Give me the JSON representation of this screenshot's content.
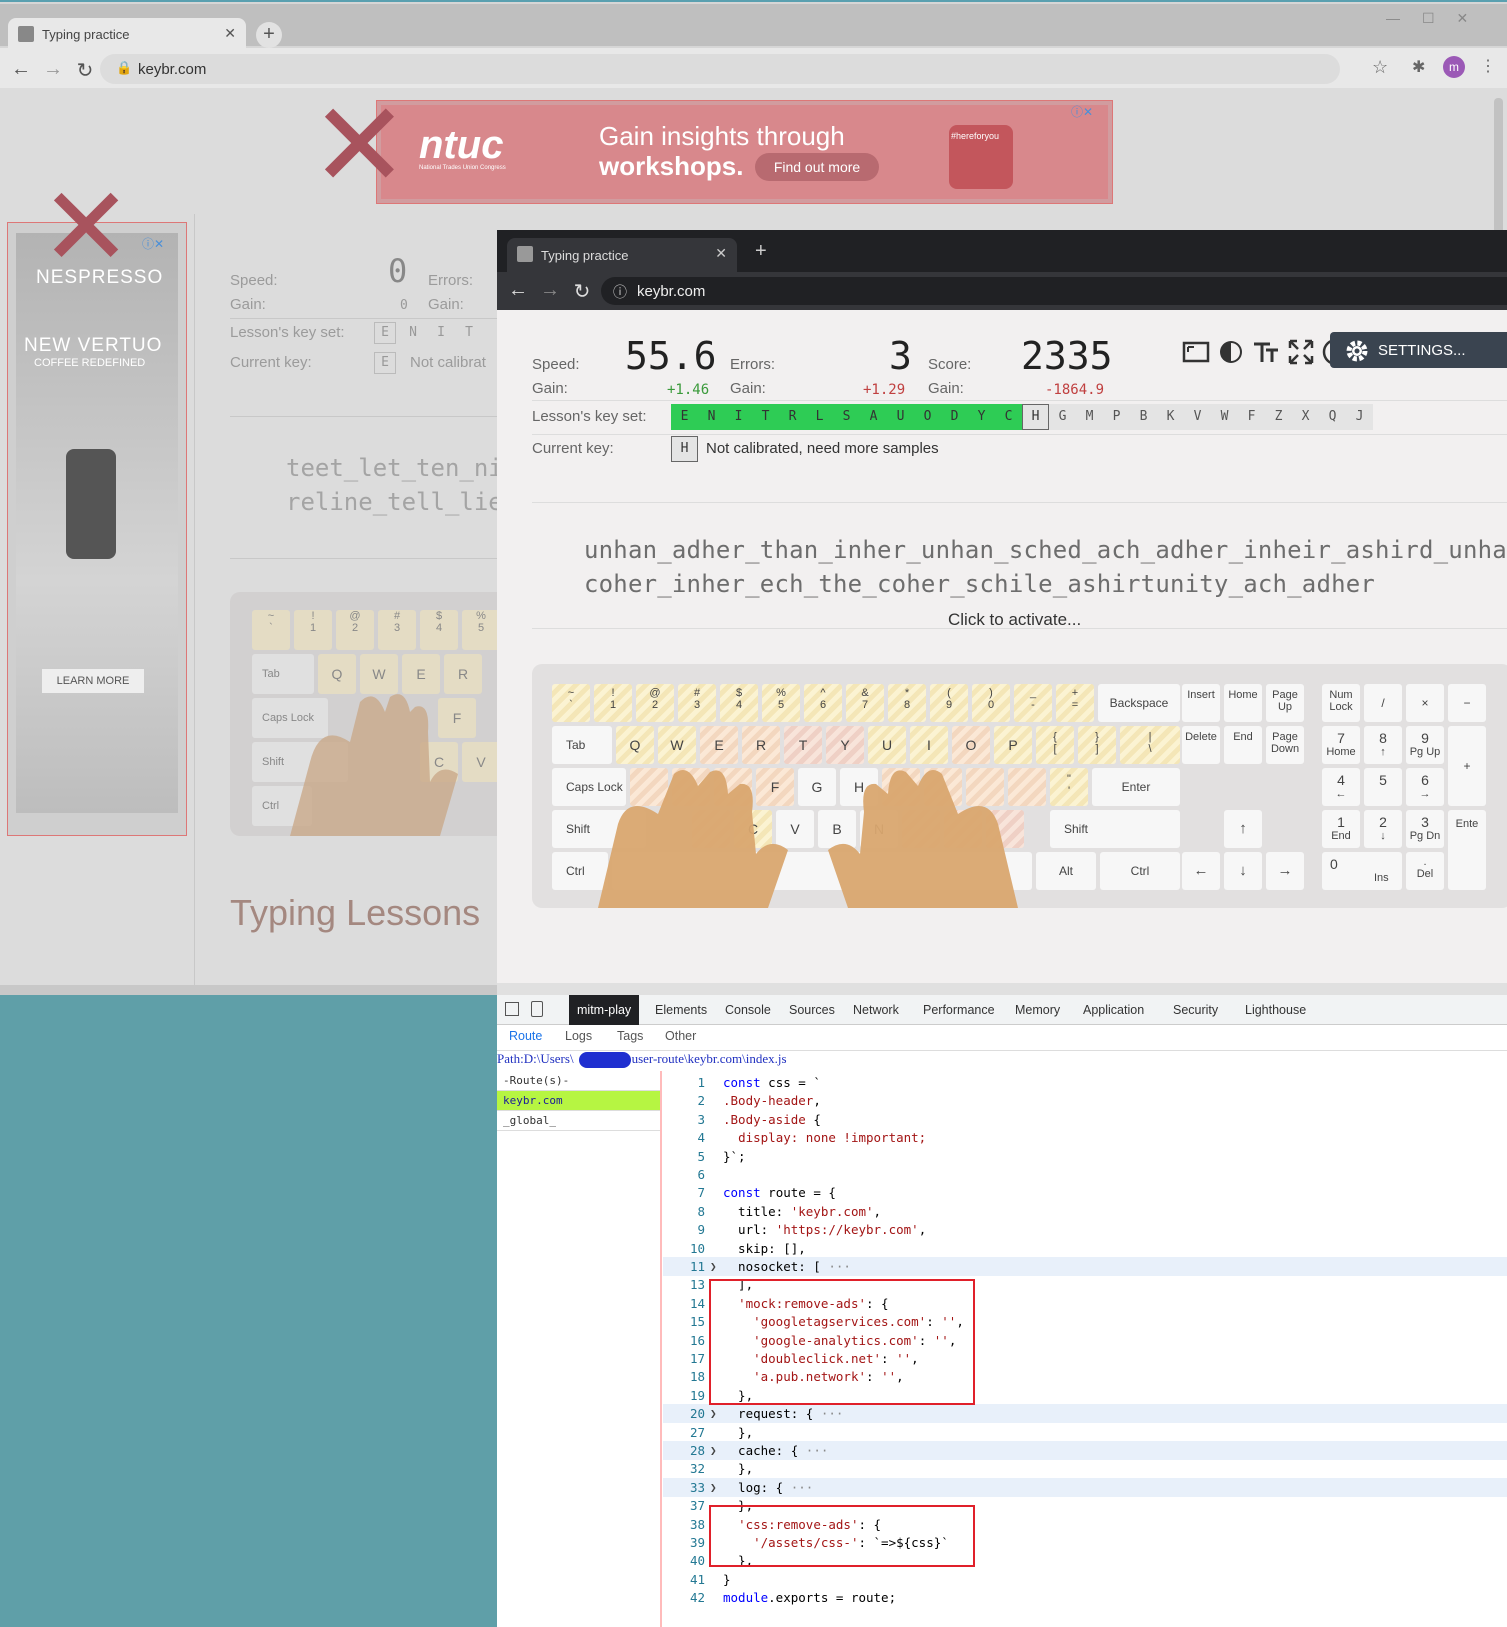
{
  "back_browser": {
    "tab_title": "Typing practice",
    "url": "keybr.com",
    "ad_top": {
      "brand": "ntuc",
      "brand_sub": "National Trades Union Congress",
      "headline_1": "Gain insights through",
      "headline_2": "workshops.",
      "cta": "Find out more",
      "tag": "#hereforyou"
    },
    "ad_side": {
      "brand": "NESPRESSO",
      "headline": "NEW VERTUO",
      "sub": "COFFEE REDEFINED",
      "cta": "LEARN MORE"
    },
    "stats": {
      "speed_label": "Speed:",
      "speed_value": "0",
      "gain_label": "Gain:",
      "gain_value": "0",
      "errors_label": "Errors:",
      "errors_gain_label": "Gain:",
      "lesson_label": "Lesson's key set:",
      "current_label": "Current key:",
      "current_key": "E",
      "current_text": "Not calibrat"
    },
    "lesson_keys": [
      "E",
      "N",
      "I",
      "T"
    ],
    "text_lines": [
      "teet_let_ten_nie",
      "reline_tell_lie_"
    ],
    "keyboard": {
      "row0": [
        [
          "~",
          "`"
        ],
        [
          "!",
          "1"
        ],
        [
          "@",
          "2"
        ],
        [
          "#",
          "3"
        ],
        [
          "$",
          "4"
        ],
        [
          "%",
          "5"
        ]
      ],
      "row1": [
        "Tab",
        "Q",
        "W",
        "E",
        "R"
      ],
      "row2": [
        "Caps Lock",
        "F"
      ],
      "row3": [
        "Shift",
        "C",
        "V"
      ],
      "row4": [
        "Ctrl"
      ]
    },
    "section_title": "Typing Lessons"
  },
  "front_browser": {
    "tab_title": "Typing practice",
    "url": "keybr.com",
    "stats": {
      "speed_label": "Speed:",
      "speed_value": "55.6",
      "speed_gain_label": "Gain:",
      "speed_gain": "+1.46",
      "errors_label": "Errors:",
      "errors_value": "3",
      "errors_gain_label": "Gain:",
      "errors_gain": "+1.29",
      "score_label": "Score:",
      "score_value": "2335",
      "score_gain_label": "Gain:",
      "score_gain": "-1864.9"
    },
    "settings_label": "SETTINGS...",
    "lesson_label": "Lesson's key set:",
    "lesson_keys_on": [
      "E",
      "N",
      "I",
      "T",
      "R",
      "L",
      "S",
      "A",
      "U",
      "O",
      "D",
      "Y",
      "C"
    ],
    "lesson_key_current": "H",
    "lesson_keys_off": [
      "G",
      "M",
      "P",
      "B",
      "K",
      "V",
      "W",
      "F",
      "Z",
      "X",
      "Q",
      "J"
    ],
    "current_label": "Current key:",
    "current_key": "H",
    "current_text": "Not calibrated, need more samples",
    "text_lines": [
      "unhan_adher_than_inher_unhan_sched_ach_adher_inheir_ashird_unhan_",
      "coher_inher_ech_the_coher_schile_ashirtunity_ach_adher"
    ],
    "activate_text": "Click to activate...",
    "keyboard": {
      "row0": [
        [
          "~",
          "`"
        ],
        [
          "!",
          "1"
        ],
        [
          "@",
          "2"
        ],
        [
          "#",
          "3"
        ],
        [
          "$",
          "4"
        ],
        [
          "%",
          "5"
        ],
        [
          "^",
          "6"
        ],
        [
          "&",
          "7"
        ],
        [
          "*",
          "8"
        ],
        [
          "(",
          "9"
        ],
        [
          ")",
          "0"
        ],
        [
          "_",
          "-"
        ],
        [
          "+",
          "="
        ]
      ],
      "backspace": "Backspace",
      "tab": "Tab",
      "row1": [
        "Q",
        "W",
        "E",
        "R",
        "T",
        "Y",
        "U",
        "I",
        "O",
        "P"
      ],
      "row1_extra": [
        [
          "{",
          "["
        ],
        [
          "}",
          "]"
        ],
        [
          "|",
          "\\"
        ]
      ],
      "caps": "Caps Lock",
      "row2": [
        "F",
        "G",
        "H"
      ],
      "row2_extra": [
        [
          "\"",
          "'"
        ]
      ],
      "enter": "Enter",
      "shift_l": "Shift",
      "row3": [
        "C",
        "V",
        "B",
        "N"
      ],
      "shift_r": "Shift",
      "ctrl_l": "Ctrl",
      "alt_r": "Alt",
      "ctrl_r": "Ctrl",
      "nav": [
        [
          "Insert",
          "Home",
          "Page Up"
        ],
        [
          "Delete",
          "End",
          "Page Down"
        ]
      ],
      "arrows": [
        "↑",
        "←",
        "↓",
        "→"
      ],
      "numpad": {
        "r0": [
          "Num Lock",
          "/",
          "×",
          "−"
        ],
        "r1": [
          [
            "7",
            "Home"
          ],
          [
            "8",
            "↑"
          ],
          [
            "9",
            "Pg Up"
          ],
          [
            "+",
            ""
          ]
        ],
        "r2": [
          [
            "4",
            "←"
          ],
          [
            "5",
            ""
          ],
          [
            "6",
            "→"
          ]
        ],
        "r3": [
          [
            "1",
            "End"
          ],
          [
            "2",
            "↓"
          ],
          [
            "3",
            "Pg Dn"
          ],
          [
            "Ente",
            ""
          ]
        ],
        "r4": [
          [
            "0",
            "Ins"
          ],
          [
            ".",
            "Del"
          ]
        ]
      }
    }
  },
  "devtools": {
    "tabs": [
      "mitm-play",
      "Elements",
      "Console",
      "Sources",
      "Network",
      "Performance",
      "Memory",
      "Application",
      "Security",
      "Lighthouse"
    ],
    "active_tab": "mitm-play",
    "subtabs": [
      "Route",
      "Logs",
      "Tags",
      "Other"
    ],
    "active_subtab": "Route",
    "path_prefix": "Path:D:\\Users\\",
    "path_suffix": "user-route\\keybr.com\\index.js",
    "routes_header": "-Route(s)-",
    "routes": [
      "keybr.com",
      "_global_"
    ],
    "selected_route": "keybr.com",
    "code": [
      {
        "n": "1",
        "t": "const css = `"
      },
      {
        "n": "2",
        "t": ".Body-header,"
      },
      {
        "n": "3",
        "t": ".Body-aside {"
      },
      {
        "n": "4",
        "t": "  display: none !important;"
      },
      {
        "n": "5",
        "t": "}`;"
      },
      {
        "n": "6",
        "t": ""
      },
      {
        "n": "7",
        "t": "const route = {"
      },
      {
        "n": "8",
        "t": "  title: 'keybr.com',"
      },
      {
        "n": "9",
        "t": "  url: 'https://keybr.com',"
      },
      {
        "n": "10",
        "t": "  skip: [],"
      },
      {
        "n": "11",
        "t": "  nosocket: [ ···",
        "fold": true
      },
      {
        "n": "13",
        "t": "  ],"
      },
      {
        "n": "14",
        "t": "  'mock:remove-ads': {"
      },
      {
        "n": "15",
        "t": "    'googletagservices.com': '',"
      },
      {
        "n": "16",
        "t": "    'google-analytics.com': '',"
      },
      {
        "n": "17",
        "t": "    'doubleclick.net': '',"
      },
      {
        "n": "18",
        "t": "    'a.pub.network': '',"
      },
      {
        "n": "19",
        "t": "  },"
      },
      {
        "n": "20",
        "t": "  request: { ···",
        "fold": true
      },
      {
        "n": "27",
        "t": "  },"
      },
      {
        "n": "28",
        "t": "  cache: { ···",
        "fold": true
      },
      {
        "n": "32",
        "t": "  },"
      },
      {
        "n": "33",
        "t": "  log: { ···",
        "fold": true
      },
      {
        "n": "37",
        "t": "  },"
      },
      {
        "n": "38",
        "t": "  'css:remove-ads': {"
      },
      {
        "n": "39",
        "t": "    '/assets/css-': `=>${css}`"
      },
      {
        "n": "40",
        "t": "  },"
      },
      {
        "n": "41",
        "t": "}"
      },
      {
        "n": "42",
        "t": "module.exports = route;"
      }
    ]
  }
}
